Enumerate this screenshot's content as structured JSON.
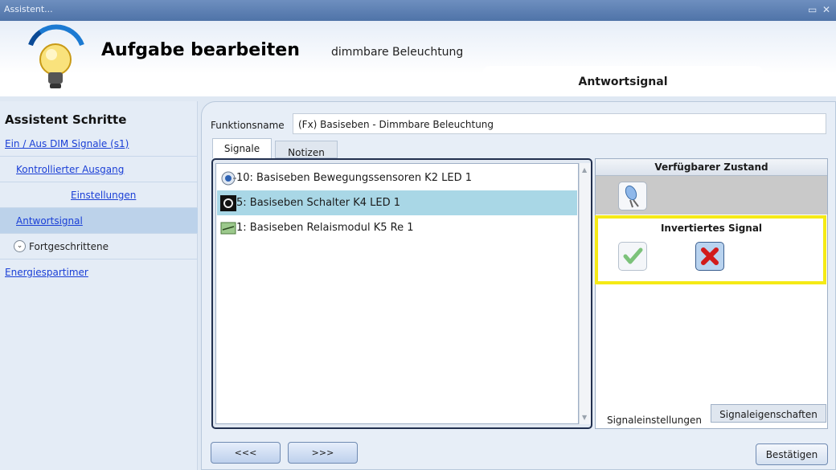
{
  "window": {
    "title": "Assistent...",
    "maximize_glyph": "▭",
    "close_glyph": "✕"
  },
  "header": {
    "title": "Aufgabe bearbeiten",
    "subtitle": "dimmbare Beleuchtung",
    "answer_tab": "Antwortsignal",
    "icon": "light-bulb-icon"
  },
  "sidebar": {
    "heading": "Assistent Schritte",
    "items": [
      {
        "label": "Ein / Aus DIM Signale (s1)"
      },
      {
        "label": "Kontrollierter Ausgang"
      },
      {
        "label": "Einstellungen"
      },
      {
        "label": "Antwortsignal"
      },
      {
        "label": "Fortgeschrittene"
      },
      {
        "label": "Energiespartimer"
      }
    ]
  },
  "form": {
    "function_label": "Funktionsname",
    "function_value": "(Fx) Basiseben - Dimmbare Beleuchtung"
  },
  "tabs": {
    "signale": "Signale",
    "notizen": "Notizen"
  },
  "signals": [
    {
      "label": "10: Basiseben Bewegungssensoren K2 LED 1",
      "icon": "motion-sensor-icon"
    },
    {
      "label": "5: Basiseben Schalter K4 LED 1",
      "icon": "switch-icon",
      "selected": true
    },
    {
      "label": "1: Basiseben Relaismodul K5 Re 1",
      "icon": "relay-icon"
    }
  ],
  "right_panel": {
    "available_state_heading": "Verfügbarer Zustand",
    "available_state_icon": "led-icon",
    "inverted_heading": "Invertiertes Signal",
    "yes_icon": "checkmark-icon",
    "no_icon": "cross-icon",
    "tab_settings": "Signaleinstellungen",
    "tab_properties": "Signaleigenschaften"
  },
  "footer": {
    "back": "<<<",
    "forward": ">>>",
    "confirm": "Bestätigen"
  },
  "colors": {
    "highlight": "#f5ea16",
    "selected_row": "#a9d7e6",
    "link": "#1a3fd6"
  }
}
